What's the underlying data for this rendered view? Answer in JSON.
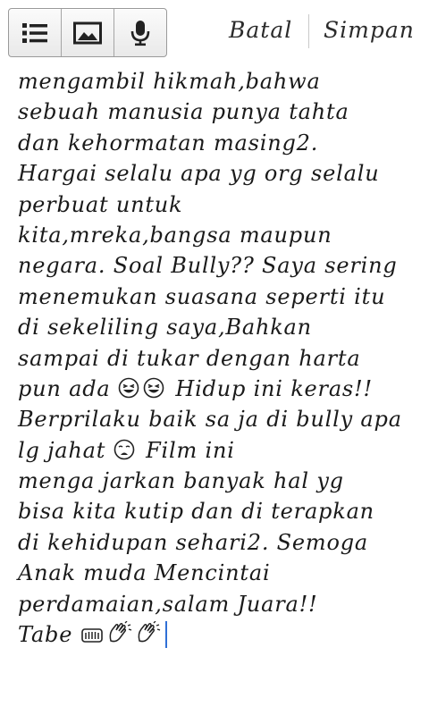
{
  "toolbar": {
    "buttons": [
      {
        "icon": "list-icon"
      },
      {
        "icon": "image-icon"
      },
      {
        "icon": "microphone-icon"
      }
    ],
    "cancel_label": "Batal",
    "save_label": "Simpan"
  },
  "editor": {
    "lines": [
      "mengambil hikmah,bahwa",
      "sebuah manusia punya tahta",
      "dan kehormatan masing2.",
      "Hargai selalu apa yg org selalu",
      "perbuat untuk",
      "kita,mreka,bangsa maupun",
      "negara. Soal Bully?? Saya sering",
      "menemukan suasana seperti itu",
      "di sekeliling saya,Bahkan",
      "sampai di tukar dengan  harta"
    ],
    "line10_text1": "pun ada ",
    "line10_text2": " Hidup ini keras!!",
    "line11": "Berprilaku baik sa ja di bully apa",
    "line12_text1": "lg jahat ",
    "line12_text2": " Film ini",
    "lines_after": [
      "menga jarkan banyak hal yg",
      "bisa kita kutip dan di terapkan",
      "di kehidupan sehari2. Semoga",
      "Anak muda Mencintai",
      "perdamaian,salam Juara!!"
    ],
    "last_line_text": "Tabe ",
    "emojis": {
      "laugh": "grinning-squint-face-icon",
      "weary": "weary-face-icon",
      "hands": "raising-hands-icon",
      "clap": "clapping-hands-icon"
    },
    "cursor_color": "#2f6fd6"
  }
}
